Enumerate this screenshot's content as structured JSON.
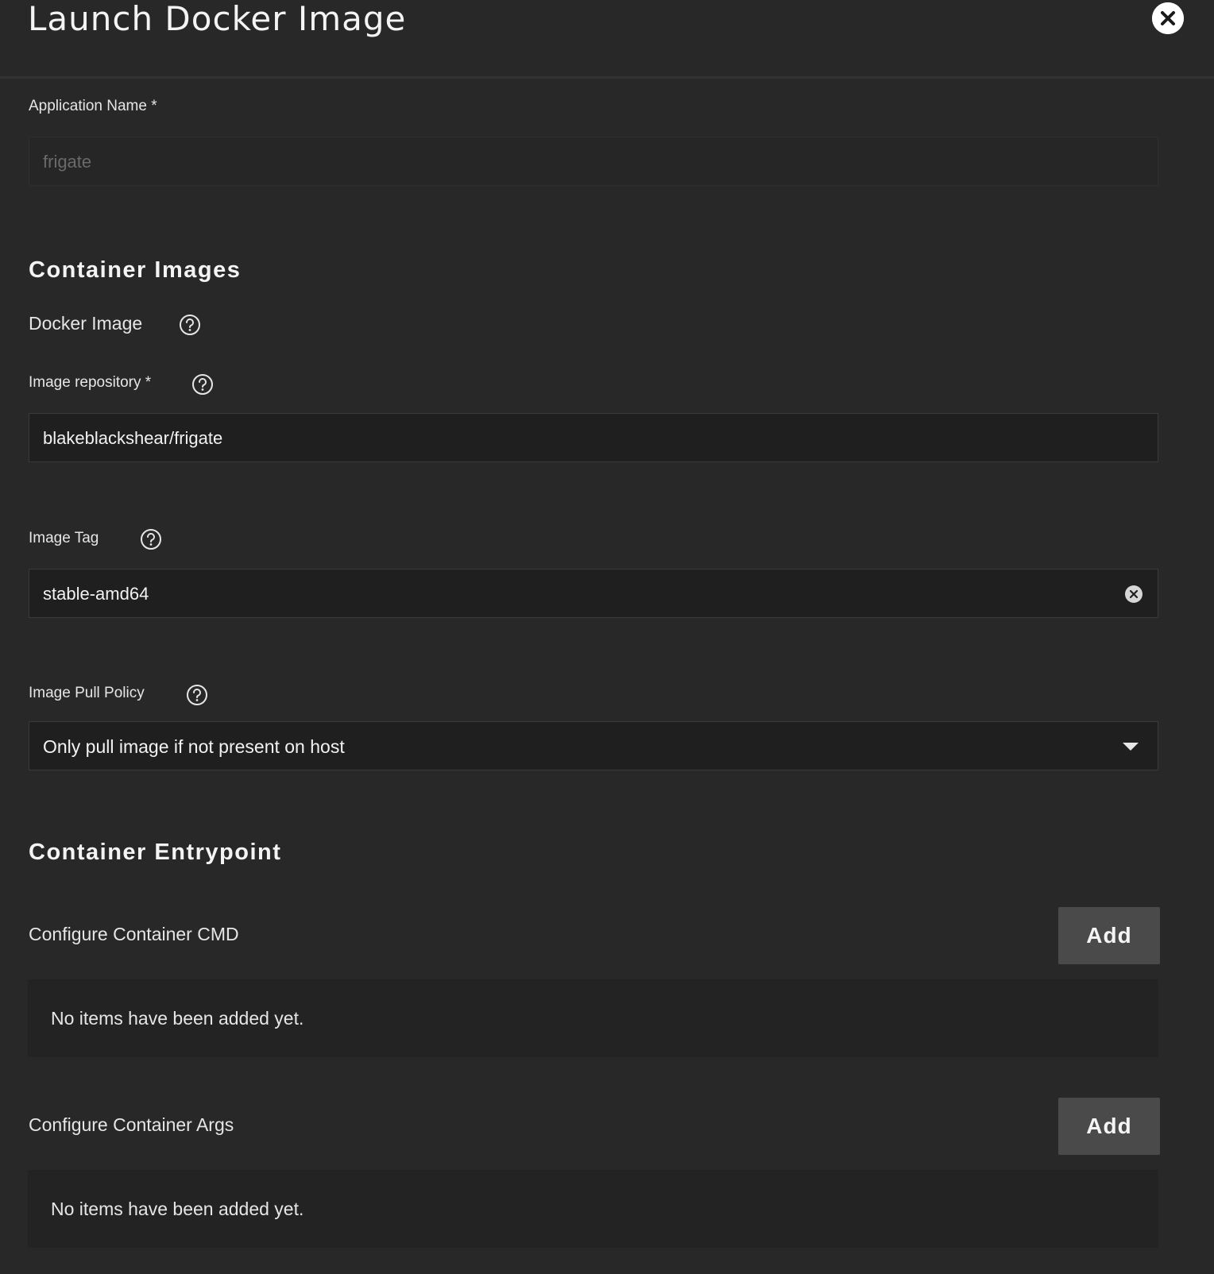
{
  "dialog": {
    "title": "Launch Docker Image",
    "close_icon": "close-icon"
  },
  "application": {
    "label": "Application Name *",
    "value": "frigate"
  },
  "container_images": {
    "section_title": "Container Images",
    "docker_image_label": "Docker Image",
    "repository": {
      "label": "Image repository *",
      "value": "blakeblackshear/frigate"
    },
    "tag": {
      "label": "Image Tag",
      "value": "stable-amd64"
    },
    "pull_policy": {
      "label": "Image Pull Policy",
      "selected": "Only pull image if not present on host"
    },
    "help_icon": "question-circle-icon"
  },
  "entrypoint": {
    "section_title": "Container Entrypoint",
    "cmd": {
      "label": "Configure Container CMD",
      "add_label": "Add",
      "empty_text": "No items have been added yet."
    },
    "args": {
      "label": "Configure Container Args",
      "add_label": "Add",
      "empty_text": "No items have been added yet."
    }
  },
  "colors": {
    "background": "#282828",
    "field_background": "#1f1f1f",
    "button_background": "#4a4a4a",
    "text": "#e6e6e6"
  }
}
